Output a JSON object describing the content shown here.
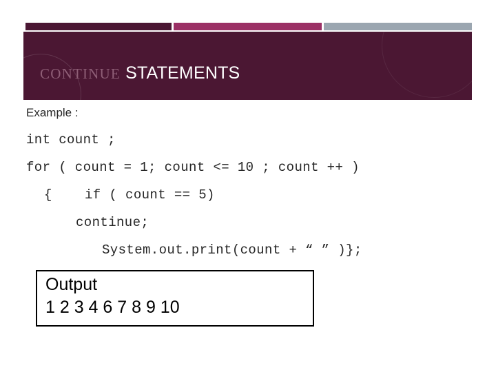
{
  "slide": {
    "background_color": "#ffffff",
    "accent_bars": [
      {
        "name": "bar-dark",
        "color": "#4B1733"
      },
      {
        "name": "bar-pink",
        "color": "#9B3065"
      },
      {
        "name": "bar-gray",
        "color": "#9BA6B0"
      }
    ],
    "header": {
      "band_color": "#4B1733",
      "title_accent": "CONTINUE",
      "title_accent_color": "#8E5E76",
      "title_main": " STATEMENTS",
      "title_main_color": "#FFFFFF"
    },
    "body": {
      "label_example": "Example :",
      "code_lines": [
        "int count ;",
        "for ( count = 1; count <= 10 ; count ++ )",
        "{    if ( count == 5)",
        "continue;",
        "System.out.print(count + “ ” )};"
      ],
      "text_color": "#262626"
    },
    "output_box": {
      "border_color": "#000000",
      "title": "Output",
      "values": "1 2 3 4 6 7 8 9 10"
    }
  }
}
